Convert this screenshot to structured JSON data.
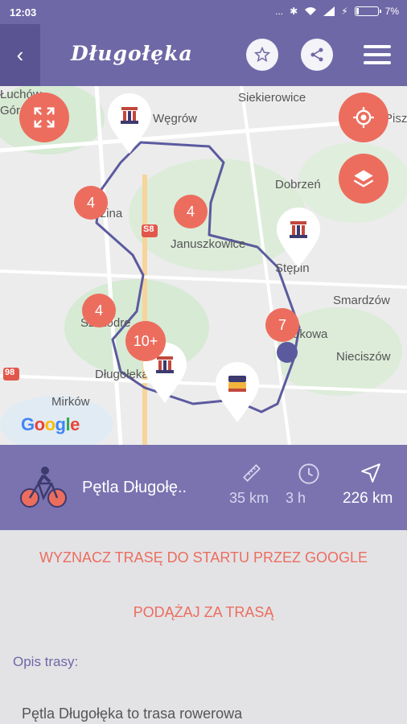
{
  "status_bar": {
    "time": "12:03",
    "signal_dots": "...",
    "battery_percent": "7%"
  },
  "header": {
    "title": "Długołęka",
    "back_icon": "chevron-left-icon",
    "favorite_icon": "star-icon",
    "share_icon": "share-icon",
    "menu_icon": "hamburger-menu-icon"
  },
  "map": {
    "places": [
      "Siekierowice",
      "Węgrów",
      "Dobrzeń",
      "Januszkowice",
      "Stępin",
      "Smardzów",
      "Nieciszów",
      "Długołęka",
      "Mirków",
      "Bukowa",
      "Szczodre",
      "Łozina"
    ],
    "edge_labels": {
      "top_left": "Łuchów",
      "top_left_2": "Górna",
      "top_right": "Pisz"
    },
    "road_badges": {
      "s8": "S8",
      "r98": "98"
    },
    "clusters": [
      "4",
      "4",
      "4",
      "10+",
      "7"
    ],
    "google_logo": "Google",
    "fullscreen_icon": "fullscreen-icon",
    "locate_icon": "my-location-icon",
    "layers_icon": "layers-icon",
    "accent_color": "#ec6d5e"
  },
  "route": {
    "name": "Pętla Długołę..",
    "bike_icon": "bicycle-icon",
    "length": "35 km",
    "duration": "3 h",
    "distance_to_start": "226 km"
  },
  "actions": {
    "navigate_google": "WYZNACZ TRASĘ DO STARTU PRZEZ GOOGLE",
    "follow_route": "PODĄŻAJ ZA TRASĄ"
  },
  "description": {
    "label": "Opis trasy:",
    "text": "Pętla Długołęka to trasa rowerowa"
  }
}
